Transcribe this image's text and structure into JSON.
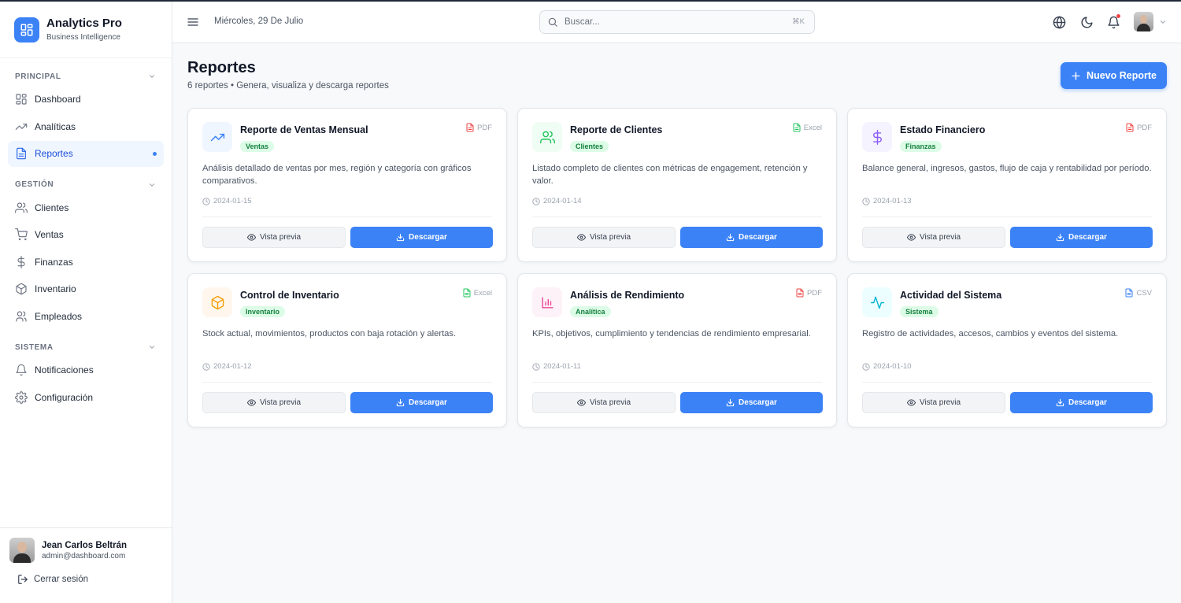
{
  "app": {
    "title": "Analytics Pro",
    "subtitle": "Business Intelligence"
  },
  "sidebar": {
    "sections": [
      {
        "label": "PRINCIPAL",
        "items": [
          {
            "label": "Dashboard",
            "icon": "grid-icon"
          },
          {
            "label": "Analíticas",
            "icon": "trending-up-icon"
          },
          {
            "label": "Reportes",
            "icon": "file-text-icon",
            "active": true
          }
        ]
      },
      {
        "label": "GESTIÓN",
        "items": [
          {
            "label": "Clientes",
            "icon": "users-icon"
          },
          {
            "label": "Ventas",
            "icon": "cart-icon"
          },
          {
            "label": "Finanzas",
            "icon": "dollar-icon"
          },
          {
            "label": "Inventario",
            "icon": "box-icon"
          },
          {
            "label": "Empleados",
            "icon": "user-group-icon"
          }
        ]
      },
      {
        "label": "SISTEMA",
        "items": [
          {
            "label": "Notificaciones",
            "icon": "bell-icon"
          },
          {
            "label": "Configuración",
            "icon": "gear-icon"
          }
        ]
      }
    ],
    "user": {
      "name": "Jean Carlos Beltrán",
      "email": "admin@dashboard.com"
    },
    "logout_label": "Cerrar sesión"
  },
  "header": {
    "date": "Miércoles, 29 De Julio",
    "search_placeholder": "Buscar...",
    "search_shortcut": "⌘K"
  },
  "page": {
    "title": "Reportes",
    "subtitle": "6 reportes • Genera, visualiza y descarga reportes",
    "new_button_label": "Nuevo Reporte"
  },
  "reports": [
    {
      "title": "Reporte de Ventas Mensual",
      "category": "Ventas",
      "format": "PDF",
      "description": "Análisis detallado de ventas por mes, región y categoría con gráficos comparativos.",
      "date": "2024-01-15",
      "icon": "trending-up-icon",
      "icon_color": "#3b82f6",
      "icon_bg": "#eff6ff",
      "format_color": "#ef4444"
    },
    {
      "title": "Reporte de Clientes",
      "category": "Clientes",
      "format": "Excel",
      "description": "Listado completo de clientes con métricas de engagement, retención y valor.",
      "date": "2024-01-14",
      "icon": "users-icon",
      "icon_color": "#22c55e",
      "icon_bg": "#f0fdf4",
      "format_color": "#22c55e"
    },
    {
      "title": "Estado Financiero",
      "category": "Finanzas",
      "format": "PDF",
      "description": "Balance general, ingresos, gastos, flujo de caja y rentabilidad por período.",
      "date": "2024-01-13",
      "icon": "dollar-icon",
      "icon_color": "#8b5cf6",
      "icon_bg": "#f5f3ff",
      "format_color": "#ef4444"
    },
    {
      "title": "Control de Inventario",
      "category": "Inventario",
      "format": "Excel",
      "description": "Stock actual, movimientos, productos con baja rotación y alertas.",
      "date": "2024-01-12",
      "icon": "box-icon",
      "icon_color": "#f59e0b",
      "icon_bg": "#fff7ed",
      "format_color": "#22c55e"
    },
    {
      "title": "Análisis de Rendimiento",
      "category": "Analítica",
      "format": "PDF",
      "description": "KPIs, objetivos, cumplimiento y tendencias de rendimiento empresarial.",
      "date": "2024-01-11",
      "icon": "bar-chart-icon",
      "icon_color": "#ec4899",
      "icon_bg": "#fdf2f8",
      "format_color": "#ef4444"
    },
    {
      "title": "Actividad del Sistema",
      "category": "Sistema",
      "format": "CSV",
      "description": "Registro de actividades, accesos, cambios y eventos del sistema.",
      "date": "2024-01-10",
      "icon": "activity-icon",
      "icon_color": "#06b6d4",
      "icon_bg": "#ecfeff",
      "format_color": "#3b82f6"
    }
  ],
  "card_buttons": {
    "preview": "Vista previa",
    "download": "Descargar"
  },
  "colors": {
    "accent": "#3b82f6",
    "badge_bg": "#dcfce7",
    "badge_text": "#15803d"
  }
}
